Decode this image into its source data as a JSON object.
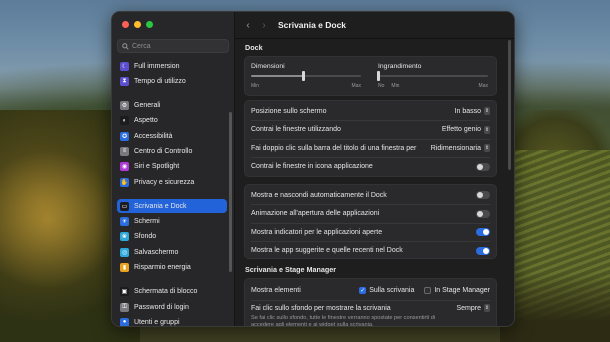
{
  "window": {
    "title": "Scrivania e Dock"
  },
  "search": {
    "placeholder": "Cerca"
  },
  "sidebar": {
    "items": [
      {
        "label": "Full immersion",
        "icon": "moon-icon",
        "color": "#5b4fd0"
      },
      {
        "label": "Tempo di utilizzo",
        "icon": "hourglass-icon",
        "color": "#5b4fd0"
      },
      {
        "label": "Generali",
        "icon": "gear-icon",
        "color": "#7a7a7e"
      },
      {
        "label": "Aspetto",
        "icon": "appearance-icon",
        "color": "#1c1c1e"
      },
      {
        "label": "Accessibilità",
        "icon": "accessibility-icon",
        "color": "#2b6cdf"
      },
      {
        "label": "Centro di Controllo",
        "icon": "control-center-icon",
        "color": "#7a7a7e"
      },
      {
        "label": "Siri e Spotlight",
        "icon": "siri-icon",
        "color": "#b03ad6"
      },
      {
        "label": "Privacy e sicurezza",
        "icon": "hand-icon",
        "color": "#2b6cdf"
      },
      {
        "label": "Scrivania e Dock",
        "icon": "dock-icon",
        "color": "#1c1c1e",
        "active": true
      },
      {
        "label": "Schermi",
        "icon": "display-icon",
        "color": "#2b6cdf"
      },
      {
        "label": "Sfondo",
        "icon": "wallpaper-icon",
        "color": "#2fa8d8"
      },
      {
        "label": "Salvaschermo",
        "icon": "screensaver-icon",
        "color": "#2fa8d8"
      },
      {
        "label": "Risparmio energia",
        "icon": "battery-icon",
        "color": "#e9a21d"
      },
      {
        "label": "Schermata di blocco",
        "icon": "lock-screen-icon",
        "color": "#1c1c1e"
      },
      {
        "label": "Password di login",
        "icon": "key-icon",
        "color": "#7a7a7e"
      },
      {
        "label": "Utenti e gruppi",
        "icon": "users-icon",
        "color": "#2b6cdf"
      }
    ]
  },
  "dock": {
    "section_title": "Dock",
    "size": {
      "label": "Dimensioni",
      "min": "Min",
      "max": "Max",
      "value": 0.48
    },
    "magnification": {
      "label": "Ingrandimento",
      "off": "No",
      "min": "Min",
      "max": "Max",
      "value": 0.0
    },
    "rows": [
      {
        "label": "Posizione sullo schermo",
        "kind": "popup",
        "value": "In basso"
      },
      {
        "label": "Contrai le finestre utilizzando",
        "kind": "popup",
        "value": "Effetto genio"
      },
      {
        "label": "Fai doppio clic sulla barra del titolo di una finestra per",
        "kind": "popup",
        "value": "Ridimensionaria"
      },
      {
        "label": "Contrai le finestre in icona applicazione",
        "kind": "toggle",
        "on": false
      }
    ],
    "rows2": [
      {
        "label": "Mostra e nascondi automaticamente il Dock",
        "kind": "toggle",
        "on": false
      },
      {
        "label": "Animazione all'apertura delle applicazioni",
        "kind": "toggle",
        "on": false
      },
      {
        "label": "Mostra indicatori per le applicazioni aperte",
        "kind": "toggle",
        "on": true
      },
      {
        "label": "Mostra le app suggerite e quelle recenti nel Dock",
        "kind": "toggle",
        "on": true
      }
    ]
  },
  "stage": {
    "section_title": "Scrivania e Stage Manager",
    "show_items": {
      "label": "Mostra elementi",
      "option1": "Sulla scrivania",
      "option1_checked": true,
      "option2": "In Stage Manager",
      "option2_checked": false
    },
    "click_wallpaper": {
      "label": "Fai clic sullo sfondo per mostrare la scrivania",
      "value": "Sempre",
      "description": "Se fai clic sullo sfondo, tutte le finestre verranno spostate per consentirti di accedere agli elementi e ai widget sulla scrivania."
    }
  }
}
